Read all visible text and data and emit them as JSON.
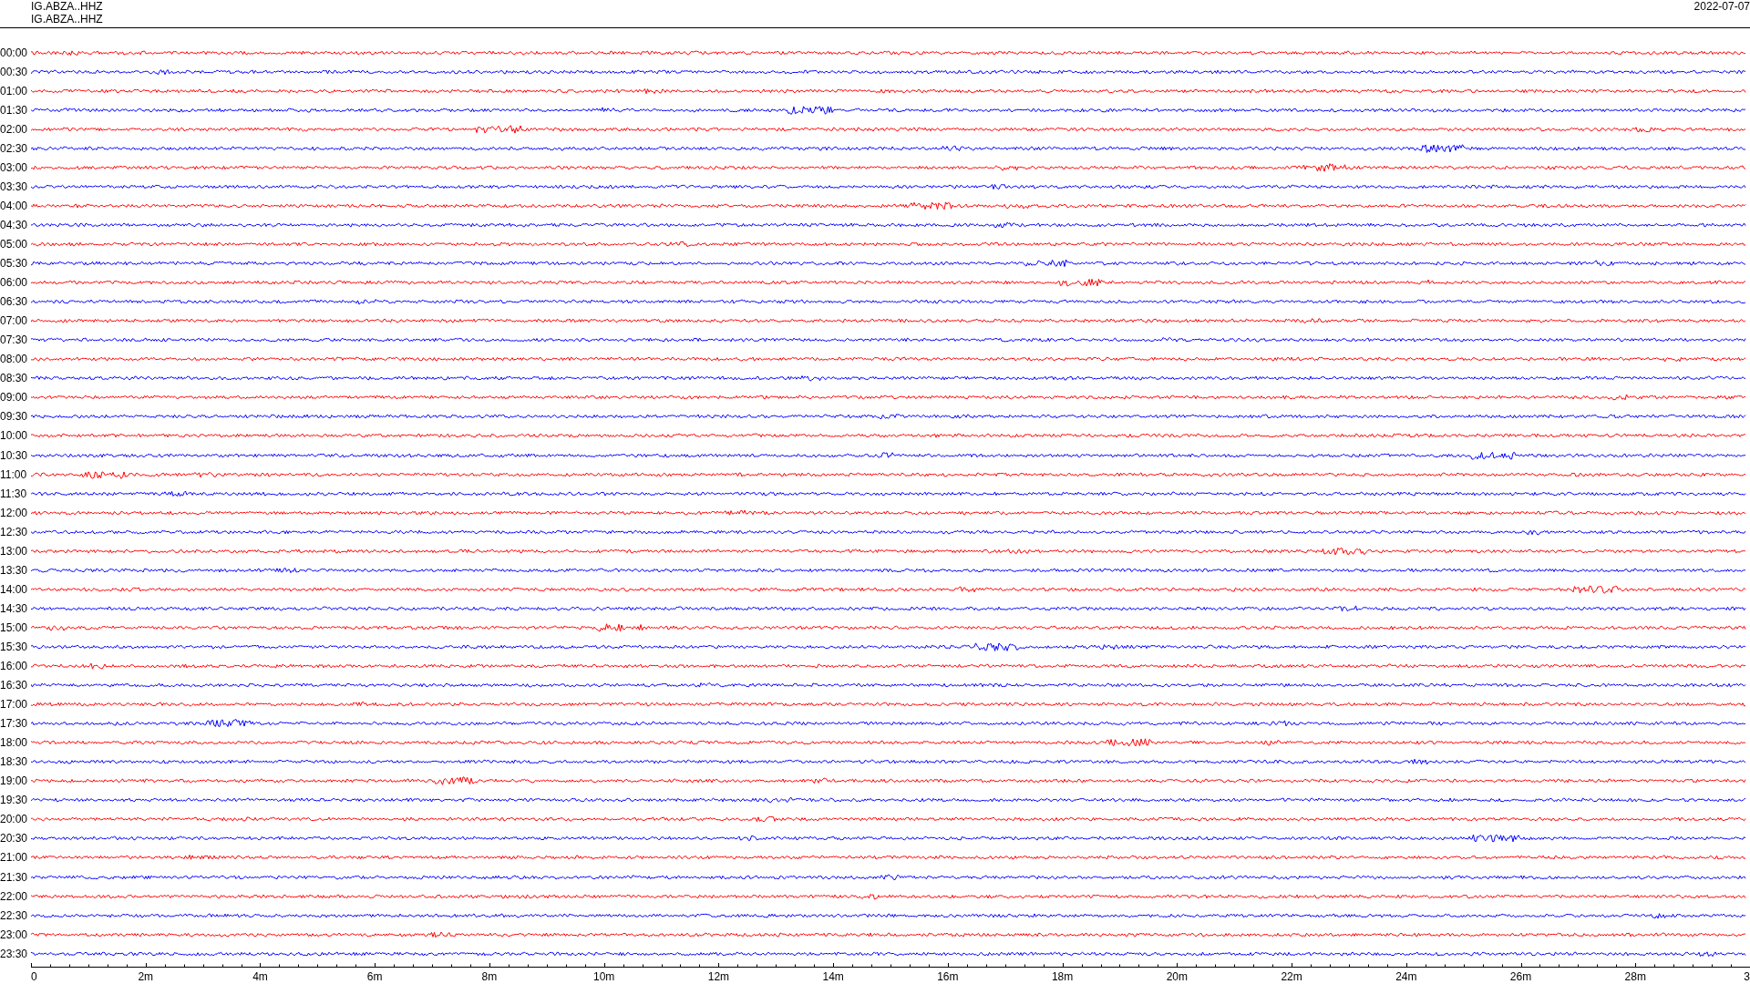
{
  "header": {
    "channels": [
      "IG.ABZA..HHZ",
      "IG.ABZA..HHZ"
    ],
    "date": "2022-07-07"
  },
  "rows": [
    {
      "time": "00:00",
      "color": "#ff0000"
    },
    {
      "time": "00:30",
      "color": "#0000ff"
    },
    {
      "time": "01:00",
      "color": "#ff0000"
    },
    {
      "time": "01:30",
      "color": "#0000ff"
    },
    {
      "time": "02:00",
      "color": "#ff0000"
    },
    {
      "time": "02:30",
      "color": "#0000ff"
    },
    {
      "time": "03:00",
      "color": "#ff0000"
    },
    {
      "time": "03:30",
      "color": "#0000ff"
    },
    {
      "time": "04:00",
      "color": "#ff0000"
    },
    {
      "time": "04:30",
      "color": "#0000ff"
    },
    {
      "time": "05:00",
      "color": "#ff0000"
    },
    {
      "time": "05:30",
      "color": "#0000ff"
    },
    {
      "time": "06:00",
      "color": "#ff0000"
    },
    {
      "time": "06:30",
      "color": "#0000ff"
    },
    {
      "time": "07:00",
      "color": "#ff0000"
    },
    {
      "time": "07:30",
      "color": "#0000ff"
    },
    {
      "time": "08:00",
      "color": "#ff0000"
    },
    {
      "time": "08:30",
      "color": "#0000ff"
    },
    {
      "time": "09:00",
      "color": "#ff0000"
    },
    {
      "time": "09:30",
      "color": "#0000ff"
    },
    {
      "time": "10:00",
      "color": "#ff0000"
    },
    {
      "time": "10:30",
      "color": "#0000ff"
    },
    {
      "time": "11:00",
      "color": "#ff0000"
    },
    {
      "time": "11:30",
      "color": "#0000ff"
    },
    {
      "time": "12:00",
      "color": "#ff0000"
    },
    {
      "time": "12:30",
      "color": "#0000ff"
    },
    {
      "time": "13:00",
      "color": "#ff0000"
    },
    {
      "time": "13:30",
      "color": "#0000ff"
    },
    {
      "time": "14:00",
      "color": "#ff0000"
    },
    {
      "time": "14:30",
      "color": "#0000ff"
    },
    {
      "time": "15:00",
      "color": "#ff0000"
    },
    {
      "time": "15:30",
      "color": "#0000ff"
    },
    {
      "time": "16:00",
      "color": "#ff0000"
    },
    {
      "time": "16:30",
      "color": "#0000ff"
    },
    {
      "time": "17:00",
      "color": "#ff0000"
    },
    {
      "time": "17:30",
      "color": "#0000ff"
    },
    {
      "time": "18:00",
      "color": "#ff0000"
    },
    {
      "time": "18:30",
      "color": "#0000ff"
    },
    {
      "time": "19:00",
      "color": "#ff0000"
    },
    {
      "time": "19:30",
      "color": "#0000ff"
    },
    {
      "time": "20:00",
      "color": "#ff0000"
    },
    {
      "time": "20:30",
      "color": "#0000ff"
    },
    {
      "time": "21:00",
      "color": "#ff0000"
    },
    {
      "time": "21:30",
      "color": "#0000ff"
    },
    {
      "time": "22:00",
      "color": "#ff0000"
    },
    {
      "time": "22:30",
      "color": "#0000ff"
    },
    {
      "time": "23:00",
      "color": "#ff0000"
    },
    {
      "time": "23:30",
      "color": "#0000ff"
    }
  ],
  "x_axis": {
    "ticks": [
      "0",
      "2m",
      "4m",
      "6m",
      "8m",
      "10m",
      "12m",
      "14m",
      "16m",
      "18m",
      "20m",
      "22m",
      "24m",
      "26m",
      "28m",
      "3"
    ]
  }
}
